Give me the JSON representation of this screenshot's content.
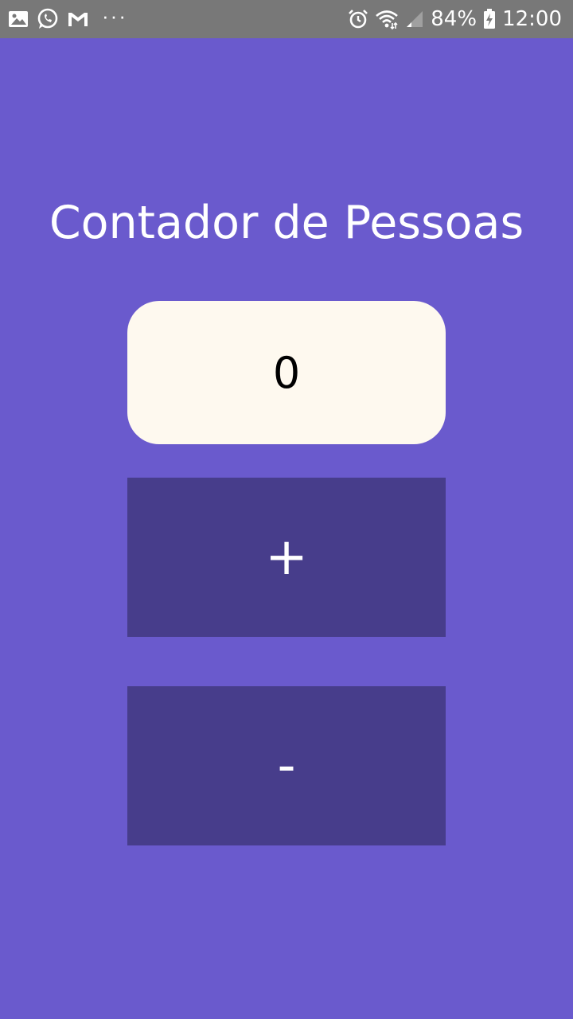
{
  "status_bar": {
    "left_icons": [
      "gallery-icon",
      "whatsapp-icon",
      "gmail-icon"
    ],
    "more_dots": "···",
    "right_icons": [
      "alarm-icon",
      "wifi-icon",
      "signal-icon"
    ],
    "battery_percent": "84%",
    "battery_icon": "battery-charging-icon",
    "time": "12:00"
  },
  "app": {
    "title": "Contador de Pessoas",
    "counter_value": "0",
    "increment_label": "+",
    "decrement_label": "-"
  },
  "colors": {
    "background": "#6a5acd",
    "button": "#473d8b",
    "counter_box": "#fef9ef",
    "status_bar": "#787878"
  }
}
